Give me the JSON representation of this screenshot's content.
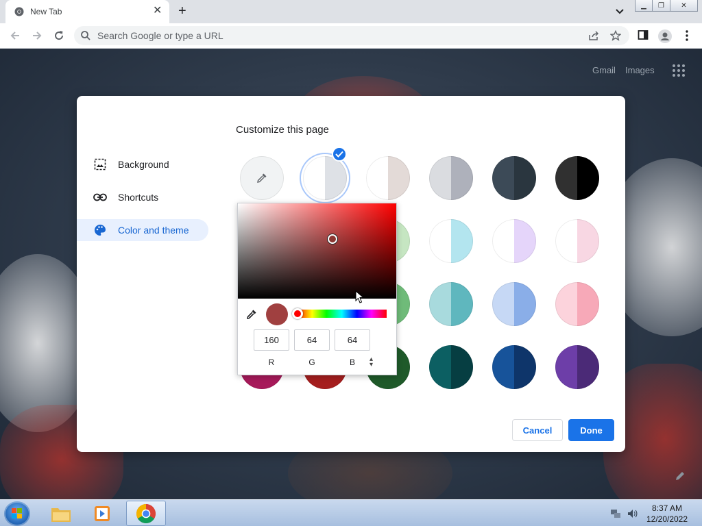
{
  "browser": {
    "tab_title": "New Tab",
    "omnibox_placeholder": "Search Google or type a URL"
  },
  "ntp": {
    "gmail_link": "Gmail",
    "images_link": "Images"
  },
  "dialog": {
    "title": "Customize this page",
    "nav": [
      {
        "label": "Background",
        "icon": "image-icon"
      },
      {
        "label": "Shortcuts",
        "icon": "link-icon"
      },
      {
        "label": "Color and theme",
        "icon": "palette-icon",
        "active": true
      }
    ],
    "cancel_label": "Cancel",
    "done_label": "Done"
  },
  "theme_swatches": [
    {
      "id": "custom",
      "left": "#f1f3f4",
      "right": "#f1f3f4",
      "icon": "eyedropper-icon"
    },
    {
      "id": "default",
      "left": "#ffffff",
      "right": "#dee1e6",
      "selected": true
    },
    {
      "id": "warm-grey",
      "left": "#ffffff",
      "right": "#e3dad7"
    },
    {
      "id": "cool-grey",
      "left": "#dadce0",
      "right": "#aeb1bb"
    },
    {
      "id": "slate",
      "left": "#3c4a57",
      "right": "#2a363f"
    },
    {
      "id": "black",
      "left": "#303030",
      "right": "#000000"
    },
    {
      "id": "aqua-light",
      "left": "#ffffff",
      "right": "#b3e5ef"
    },
    {
      "id": "lavender-light",
      "left": "#ffffff",
      "right": "#e5d5fa"
    },
    {
      "id": "pink-light",
      "left": "#ffffff",
      "right": "#f8d7e3"
    },
    {
      "id": "aqua",
      "left": "#a8dadd",
      "right": "#5fb7be"
    },
    {
      "id": "periwinkle",
      "left": "#c6d8f5",
      "right": "#8aaee8"
    },
    {
      "id": "rose",
      "left": "#fcd3dc",
      "right": "#f7a9b8"
    },
    {
      "id": "teal-dark",
      "left": "#0c5f62",
      "right": "#063e42"
    },
    {
      "id": "navy",
      "left": "#17539a",
      "right": "#0e356a"
    },
    {
      "id": "purple",
      "left": "#6d3ea8",
      "right": "#4b2a77"
    }
  ],
  "hidden_swatches": {
    "row2_col3": "#c6e6c2",
    "row3_col3": "#6fbb79",
    "row4_col1": "#a71a5a",
    "row4_col2": "#a51e1e",
    "row4_col3": "#1f5a2a"
  },
  "color_picker": {
    "current_color": "#a04040",
    "r": "160",
    "g": "64",
    "b": "64",
    "r_label": "R",
    "g_label": "G",
    "b_label": "B"
  },
  "taskbar": {
    "time": "8:37 AM",
    "date": "12/20/2022"
  }
}
